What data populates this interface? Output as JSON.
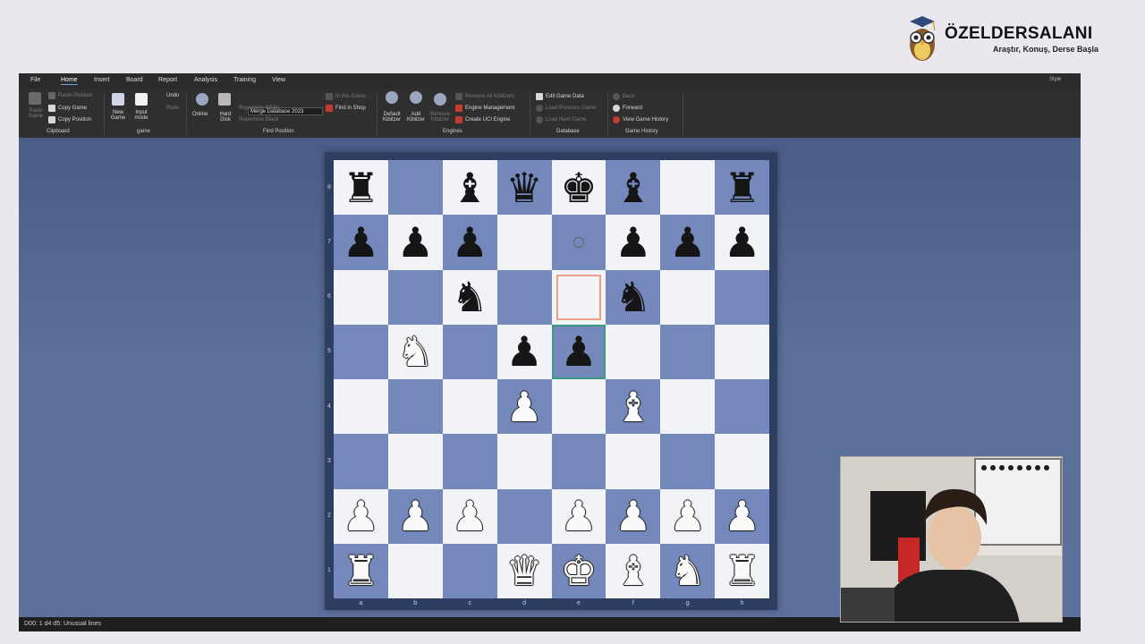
{
  "brand": {
    "name": "ÖZELDERSALANI",
    "tagline": "Araştır, Konuş, Derse Başla"
  },
  "menu": {
    "items": [
      "File",
      "Home",
      "Insert",
      "Board",
      "Report",
      "Analysis",
      "Training",
      "View"
    ],
    "active": "Home",
    "style_label": "Style"
  },
  "ribbon": {
    "clipboard": {
      "group": "Clipboard",
      "paste_game": "Paste Game",
      "paste_position": "Paste Position",
      "copy_game": "Copy Game",
      "copy_position": "Copy Position"
    },
    "game": {
      "group": "game",
      "new_game": "New Game",
      "input_mode": "Input mode",
      "undo": "Undo",
      "redo": "Redo"
    },
    "find": {
      "group": "Find Position",
      "online": "Online",
      "hard_disk": "Hard Disk",
      "database": "Merge Database 2023",
      "repertoire_white": "Repertoire White",
      "repertoire_black": "Repertoire Black",
      "in_this_game": "In this Game",
      "find_in_shop": "Find in Shop"
    },
    "engines": {
      "group": "Engines",
      "default_kibitzer": "Default Kibitzer",
      "add_kibitzer": "Add Kibitzer",
      "remove_kibitzer": "Remove Kibitzer",
      "remove_all": "Remove All Kibitzers",
      "engine_management": "Engine Management",
      "create_uci": "Create UCI Engine"
    },
    "database": {
      "group": "Database",
      "edit_game_data": "Edit Game Data",
      "load_previous": "Load Previous Game",
      "load_next": "Load Next Game"
    },
    "history": {
      "group": "Game History",
      "back": "Back",
      "forward": "Forward",
      "view_history": "View Game History"
    }
  },
  "board": {
    "files": [
      "a",
      "b",
      "c",
      "d",
      "e",
      "f",
      "g",
      "h"
    ],
    "ranks": [
      "8",
      "7",
      "6",
      "5",
      "4",
      "3",
      "2",
      "1"
    ],
    "position": [
      [
        "r",
        "",
        "b",
        "q",
        "k",
        "b",
        "",
        "r"
      ],
      [
        "p",
        "p",
        "p",
        "",
        "",
        "p",
        "p",
        "p"
      ],
      [
        "",
        "",
        "n",
        "",
        "",
        "n",
        "",
        ""
      ],
      [
        "",
        "N",
        "",
        "p",
        "p",
        "",
        "",
        ""
      ],
      [
        "",
        "",
        "",
        "P",
        "",
        "B",
        "",
        ""
      ],
      [
        "",
        "",
        "",
        "",
        "",
        "",
        "",
        ""
      ],
      [
        "P",
        "P",
        "P",
        "",
        "P",
        "P",
        "P",
        "P"
      ],
      [
        "R",
        "",
        "",
        "Q",
        "K",
        "B",
        "N",
        "R"
      ]
    ],
    "last_move_from": "e6",
    "last_move_to": "e5",
    "marker_square": "e7"
  },
  "status": {
    "text": "D00: 1 d4 d5: Unusual lines"
  },
  "colors": {
    "light_square": "#f2f3f6",
    "dark_square": "#7488bb",
    "highlight_from": "#e8a08a",
    "highlight_to": "#3a9b85"
  }
}
